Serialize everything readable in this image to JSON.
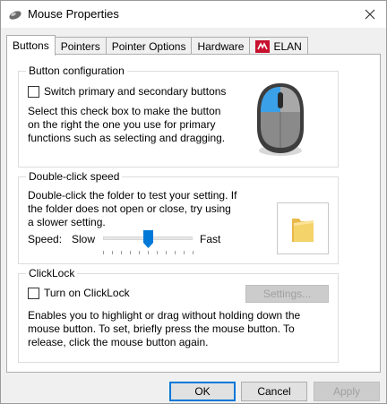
{
  "window": {
    "title": "Mouse Properties"
  },
  "tabs": [
    {
      "label": "Buttons",
      "active": true
    },
    {
      "label": "Pointers",
      "active": false
    },
    {
      "label": "Pointer Options",
      "active": false
    },
    {
      "label": "Hardware",
      "active": false
    },
    {
      "label": "ELAN",
      "active": false
    }
  ],
  "button_config": {
    "title": "Button configuration",
    "checkbox_label": "Switch primary and secondary buttons",
    "checked": false,
    "description": "Select this check box to make the button on the right the one you use for primary functions such as selecting and dragging."
  },
  "double_click": {
    "title": "Double-click speed",
    "description": "Double-click the folder to test your setting. If the folder does not open or close, try using a slower setting.",
    "speed_label": "Speed:",
    "slow_label": "Slow",
    "fast_label": "Fast",
    "speed_value": 0.5,
    "tick_count": 11
  },
  "clicklock": {
    "title": "ClickLock",
    "checkbox_label": "Turn on ClickLock",
    "checked": false,
    "settings_label": "Settings...",
    "description": "Enables you to highlight or drag without holding down the mouse button. To set, briefly press the mouse button. To release, click the mouse button again."
  },
  "footer": {
    "ok_label": "OK",
    "cancel_label": "Cancel",
    "apply_label": "Apply"
  },
  "colors": {
    "accent": "#0078d7",
    "mouse_body": "#444444",
    "mouse_highlight": "#3aa0e8",
    "folder": "#f5d36b"
  }
}
